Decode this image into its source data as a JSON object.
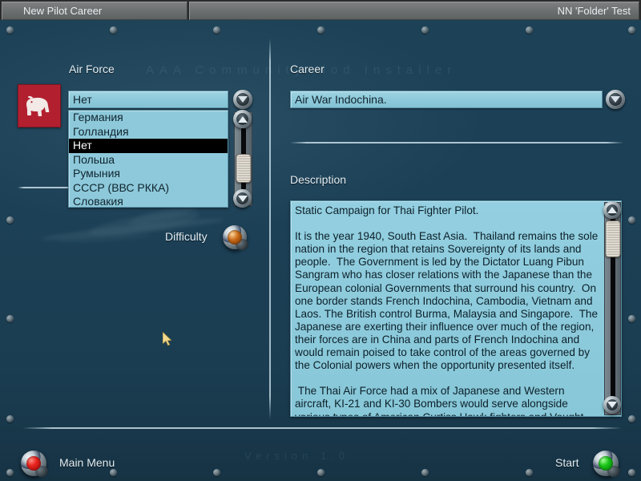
{
  "titlebar": {
    "left_title": "New Pilot Career",
    "right_title": "NN 'Folder' Test"
  },
  "watermarks": {
    "top": "AAA Community Mod Installer",
    "version": "Version 1.0"
  },
  "left_panel": {
    "air_force_label": "Air Force",
    "emblem_name": "white-elephant-siam-emblem",
    "combo_value": "Нет",
    "combo_arrow_icon": "chevron-down-icon",
    "list_items": [
      {
        "label": "Германия",
        "selected": false
      },
      {
        "label": "Голландия",
        "selected": false
      },
      {
        "label": "Нет",
        "selected": true
      },
      {
        "label": "Польша",
        "selected": false
      },
      {
        "label": "Румыния",
        "selected": false
      },
      {
        "label": "СССР (ВВС РККА)",
        "selected": false
      },
      {
        "label": "Словакия",
        "selected": false
      }
    ],
    "scroll_up_icon": "triangle-up-icon",
    "scroll_down_icon": "triangle-down-icon",
    "difficulty_label": "Difficulty",
    "difficulty_button_icon": "amber-jewel-button"
  },
  "right_panel": {
    "career_label": "Career",
    "career_value": "Air War Indochina.",
    "career_arrow_icon": "chevron-down-icon",
    "description_label": "Description",
    "description_text": "Static Campaign for Thai Fighter Pilot.\n\nIt is the year 1940, South East Asia.  Thailand remains the sole nation in the region that retains Sovereignty of its lands and people.  The Government is led by the Dictator Luang Pibun Sangram who has closer relations with the Japanese than the European colonial Governments that surround his country.  On one border stands French Indochina, Cambodia, Vietnam and Laos. The British control Burma, Malaysia and Singapore.  The Japanese are exerting their influence over much of the region, their forces are in China and parts of French Indochina and would remain poised to take control of the areas governed by the Colonial powers when the opportunity presented itself.\n\n The Thai Air Force had a mix of Japanese and Western aircraft, KI-21 and KI-30 Bombers would serve alongside various types of American Curtiss Hawk fighters and Vought Corsairs, with a mix of European types making up"
  },
  "footer": {
    "main_menu_label": "Main Menu",
    "main_menu_icon": "red-jewel-button",
    "start_label": "Start",
    "start_icon": "green-jewel-button"
  },
  "colors": {
    "background_blue": "#1c4056",
    "field_blue": "#8dc9da",
    "selection_black": "#000000",
    "emblem_red": "#b22030",
    "text_light": "#e3eef4",
    "text_dark": "#10242e"
  }
}
